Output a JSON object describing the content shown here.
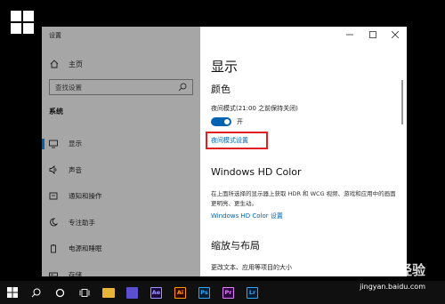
{
  "window": {
    "title": "设置",
    "controls": {
      "minimize": "—",
      "maximize": "☐",
      "close": "✕"
    }
  },
  "sidebar": {
    "home_label": "主页",
    "search_placeholder": "查找设置",
    "section_label": "系统",
    "items": [
      {
        "label": "显示",
        "icon": "monitor-icon",
        "active": true
      },
      {
        "label": "声音",
        "icon": "speaker-icon",
        "active": false
      },
      {
        "label": "通知和操作",
        "icon": "notification-icon",
        "active": false
      },
      {
        "label": "专注助手",
        "icon": "moon-icon",
        "active": false
      },
      {
        "label": "电源和睡眠",
        "icon": "power-icon",
        "active": false
      },
      {
        "label": "存储",
        "icon": "storage-icon",
        "active": false
      }
    ]
  },
  "content": {
    "title": "显示",
    "color_section": {
      "heading": "颜色",
      "night_light_label": "夜间模式(21:00 之前保持关闭)",
      "toggle_state": "开",
      "toggle_on": true,
      "night_light_settings_link": "夜间模式设置"
    },
    "hd_section": {
      "heading": "Windows HD Color",
      "description": "在上面所选择的显示器上获取 HDR 和 WCG 视频、游戏和应用中的画面更明亮、更生动。",
      "link": "Windows HD Color 设置"
    },
    "scale_section": {
      "heading": "缩放与布局",
      "description": "更改文本、应用等项目的大小"
    }
  },
  "taskbar": {
    "apps": [
      {
        "name": "file-explorer-icon",
        "text": "",
        "color": "#e8b339"
      },
      {
        "name": "media-app-icon",
        "text": "",
        "color": "#5a4fcf"
      },
      {
        "name": "after-effects-icon",
        "text": "Ae",
        "color": "#1f0740",
        "fg": "#9999ff"
      },
      {
        "name": "illustrator-icon",
        "text": "Ai",
        "color": "#330000",
        "fg": "#ff9a00"
      },
      {
        "name": "photoshop-icon",
        "text": "Ps",
        "color": "#001e36",
        "fg": "#31a8ff"
      },
      {
        "name": "premiere-icon",
        "text": "Pr",
        "color": "#2a003f",
        "fg": "#e77bff"
      },
      {
        "name": "lightroom-icon",
        "text": "Lr",
        "color": "#001a33",
        "fg": "#31a8ff"
      }
    ]
  },
  "watermark": {
    "text": "Bai 经验",
    "url": "jingyan.baidu.com"
  },
  "colors": {
    "accent": "#0063b1",
    "sidebar_bg": "#a6a6a6",
    "highlight_box": "#e02020"
  }
}
